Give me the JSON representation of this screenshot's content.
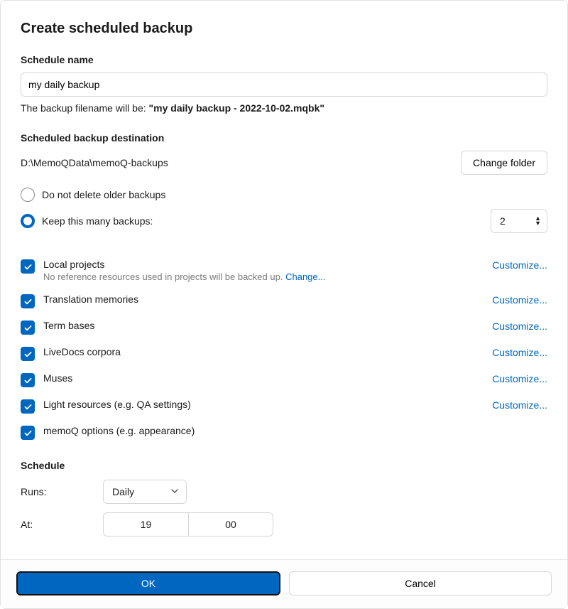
{
  "title": "Create scheduled backup",
  "schedule_name": {
    "label": "Schedule name",
    "value": "my daily backup",
    "hint_prefix": "The backup filename will be: ",
    "hint_quoted": "\"my daily backup - 2022-10-02.mqbk\""
  },
  "destination": {
    "label": "Scheduled backup destination",
    "path": "D:\\MemoQData\\memoQ-backups",
    "change_folder_btn": "Change folder",
    "option_no_delete": "Do not delete older backups",
    "option_keep": "Keep this many backups:",
    "selected": "keep",
    "keep_value": "2"
  },
  "items": [
    {
      "label": "Local projects",
      "sub_text": "No reference resources used in projects will be backed up.",
      "sub_link": "Change...",
      "customize": "Customize..."
    },
    {
      "label": "Translation memories",
      "customize": "Customize..."
    },
    {
      "label": "Term bases",
      "customize": "Customize..."
    },
    {
      "label": "LiveDocs corpora",
      "customize": "Customize..."
    },
    {
      "label": "Muses",
      "customize": "Customize..."
    },
    {
      "label": "Light resources (e.g. QA settings)",
      "customize": "Customize..."
    },
    {
      "label": "memoQ options (e.g. appearance)"
    }
  ],
  "schedule": {
    "label": "Schedule",
    "runs_label": "Runs:",
    "runs_value": "Daily",
    "at_label": "At:",
    "hour": "19",
    "minute": "00"
  },
  "footer": {
    "ok": "OK",
    "cancel": "Cancel"
  }
}
